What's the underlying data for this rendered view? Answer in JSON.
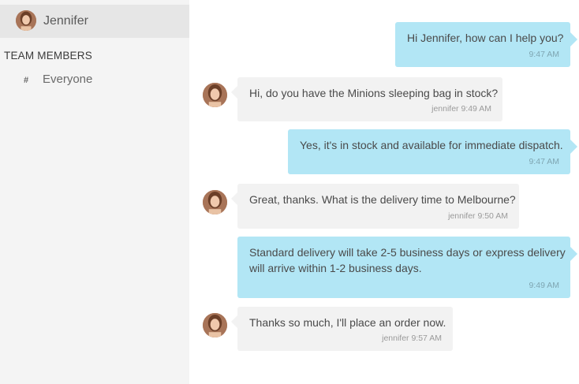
{
  "sidebar": {
    "contact": {
      "name": "Jennifer",
      "avatar_icon": "user-avatar"
    },
    "section_title": "TEAM MEMBERS",
    "channels": [
      {
        "hash": "#",
        "label": "Everyone"
      }
    ]
  },
  "messages": [
    {
      "direction": "outgoing",
      "text": "Hi Jennifer, how can I help you?",
      "meta": "9:47 AM"
    },
    {
      "direction": "incoming",
      "text": "Hi, do you have the Minions sleeping bag in stock?",
      "meta": "jennifer 9:49 AM"
    },
    {
      "direction": "outgoing",
      "text": "Yes, it's in stock and available for immediate dispatch.",
      "meta": "9:47 AM"
    },
    {
      "direction": "incoming",
      "text": "Great, thanks. What is the delivery time to Melbourne?",
      "meta": "jennifer 9:50 AM"
    },
    {
      "direction": "outgoing",
      "text_line1": "Standard delivery will take 2-5 business days or express delivery",
      "text_line2": "will arrive within 1-2 business days.",
      "meta": "9:49 AM"
    },
    {
      "direction": "incoming",
      "text": "Thanks so much, I'll place an order now.",
      "meta": "jennifer 9:57 AM"
    }
  ],
  "colors": {
    "outgoing_bubble": "#b2e6f5",
    "incoming_bubble": "#f2f2f2",
    "sidebar_bg": "#f4f4f4",
    "active_contact_bg": "#e6e6e6"
  }
}
